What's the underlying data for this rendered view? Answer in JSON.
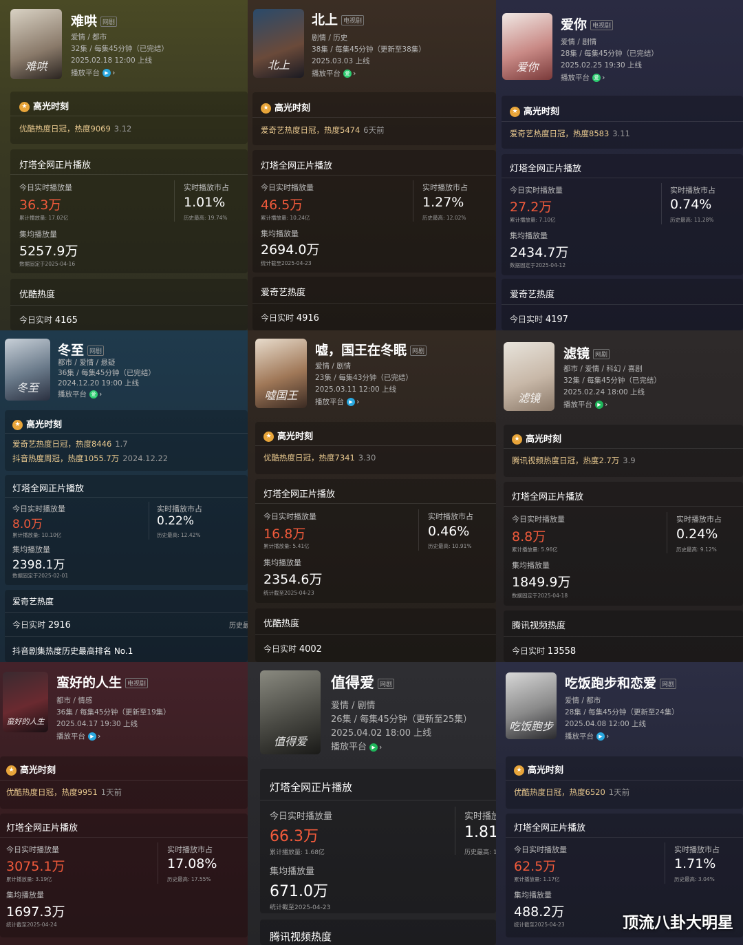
{
  "common": {
    "highlight_label": "高光时刻",
    "dengta_label": "灯塔全网正片播放",
    "today_label": "今日实时播放量",
    "share_label": "实时播放市占",
    "avg_label": "集均播放量",
    "today_live_label": "今日实时",
    "platform_label": "播放平台"
  },
  "watermark": "顶流八卦大明星",
  "cards": [
    {
      "title": "难哄",
      "tag": "网剧",
      "genre": "爱情 / 都市",
      "episodes": "32集 / 每集45分钟（已完结）",
      "release": "2025.02.18 12:00 上线",
      "poster_text": "难哄",
      "bg": "#3d3d21",
      "highlights": [
        {
          "text": "优酷热度日冠，热度9069",
          "date": "3.12"
        }
      ],
      "today": "36.3万",
      "total": "累计播放量: 17.02亿",
      "share": "1.01%",
      "share_peak": "历史最高: 19.74%",
      "avg": "5257.9万",
      "avg_note": "数据固定于2025-04-16",
      "heat_title": "优酷热度",
      "heat_value": "4165"
    },
    {
      "title": "北上",
      "tag": "电视剧",
      "genre": "剧情 / 历史",
      "episodes": "38集 / 每集45分钟（更新至38集）",
      "release": "2025.03.03 上线",
      "poster_text": "北上",
      "bg": "#2f261f",
      "highlights": [
        {
          "text": "爱奇艺热度日冠，热度5474",
          "date": "6天前"
        }
      ],
      "today": "46.5万",
      "total": "累计播放量: 10.24亿",
      "share": "1.27%",
      "share_peak": "历史最高: 12.02%",
      "avg": "2694.0万",
      "avg_note": "统计截至2025-04-23",
      "heat_title": "爱奇艺热度",
      "heat_value": "4916"
    },
    {
      "title": "爱你",
      "tag": "电视剧",
      "genre": "爱情 / 剧情",
      "episodes": "28集 / 每集45分钟（已完结）",
      "release": "2025.02.25 19:30 上线",
      "poster_text": "爱你",
      "bg": "#25263a",
      "highlights": [
        {
          "text": "爱奇艺热度日冠，热度8583",
          "date": "3.11"
        }
      ],
      "today": "27.2万",
      "total": "累计播放量: 7.10亿",
      "share": "0.74%",
      "share_peak": "历史最高: 11.28%",
      "avg": "2434.7万",
      "avg_note": "数据固定于2025-04-12",
      "heat_title": "爱奇艺热度",
      "heat_value": "4197"
    },
    {
      "title": "冬至",
      "tag": "网剧",
      "genre": "都市 / 爱情 / 悬疑",
      "episodes": "36集 / 每集45分钟（已完结）",
      "release": "2024.12.20 19:00 上线",
      "poster_text": "冬至",
      "bg": "#1d3242",
      "highlights": [
        {
          "text": "爱奇艺热度日冠，热度8446",
          "date": "1.7"
        },
        {
          "text": "抖音热度周冠，热度1055.7万",
          "date": "2024.12.22"
        }
      ],
      "today": "8.0万",
      "total": "累计播放量: 10.10亿",
      "share": "0.22%",
      "share_peak": "历史最高: 12.42%",
      "avg": "2398.1万",
      "avg_note": "数据固定于2025-02-01",
      "heat_title": "爱奇艺热度",
      "heat_value": "2916",
      "heat_extra": "历史最",
      "extra_line": "抖音剧集热度历史最高排名 No.1"
    },
    {
      "title": "嘘，国王在冬眠",
      "tag": "网剧",
      "genre": "爱情 / 剧情",
      "episodes": "23集 / 每集43分钟（已完结）",
      "release": "2025.03.11 12:00 上线",
      "poster_text": "嘘国王",
      "bg": "#2c2520",
      "highlights": [
        {
          "text": "优酷热度日冠，热度7341",
          "date": "3.30"
        }
      ],
      "today": "16.8万",
      "total": "累计播放量: 5.41亿",
      "share": "0.46%",
      "share_peak": "历史最高: 10.91%",
      "avg": "2354.6万",
      "avg_note": "统计截至2025-04-23",
      "heat_title": "优酷热度",
      "heat_value": "4002"
    },
    {
      "title": "滤镜",
      "tag": "网剧",
      "genre": "都市 / 爱情 / 科幻 / 喜剧",
      "episodes": "32集 / 每集45分钟（已完结）",
      "release": "2025.02.24 18:00 上线",
      "poster_text": "滤镜",
      "bg": "#2a2626",
      "highlights": [
        {
          "text": "腾讯视频热度日冠，热度2.7万",
          "date": "3.9"
        }
      ],
      "today": "8.8万",
      "total": "累计播放量: 5.96亿",
      "share": "0.24%",
      "share_peak": "历史最高: 9.12%",
      "avg": "1849.9万",
      "avg_note": "数据固定于2025-04-18",
      "heat_title": "腾讯视频热度",
      "heat_value": "13558"
    },
    {
      "title": "蛮好的人生",
      "tag": "电视剧",
      "genre": "都市 / 情感",
      "episodes": "36集 / 每集45分钟（更新至19集）",
      "release": "2025.04.17 19:30 上线",
      "poster_text": "蛮好的人生",
      "bg": "#3a1e22",
      "highlights": [
        {
          "text": "优酷热度日冠，热度9951",
          "date": "1天前"
        }
      ],
      "today": "3075.1万",
      "total": "累计播放量: 3.19亿",
      "share": "17.08%",
      "share_peak": "历史最高: 17.55%",
      "avg": "1697.3万",
      "avg_note": "统计截至2025-04-24"
    },
    {
      "title": "值得爱",
      "tag": "网剧",
      "genre": "爱情 / 剧情",
      "episodes": "26集 / 每集45分钟（更新至25集）",
      "release": "2025.04.02 18:00 上线",
      "poster_text": "值得爱",
      "bg": "#2a2a2e",
      "today": "66.3万",
      "total": "累计播放量: 1.68亿",
      "share": "1.81",
      "share_label_cut": "实时播放",
      "share_peak": "历史最高: 1",
      "avg": "671.0万",
      "avg_note": "统计截至2025-04-23",
      "heat_title": "腾讯视频热度"
    },
    {
      "title": "吃饭跑步和恋爱",
      "tag": "网剧",
      "genre": "爱情 / 都市",
      "episodes": "28集 / 每集45分钟（更新至24集）",
      "release": "2025.04.08 12:00 上线",
      "poster_text": "吃饭跑步",
      "bg": "#26283a",
      "highlights": [
        {
          "text": "优酷热度日冠，热度6520",
          "date": "1天前"
        }
      ],
      "today": "62.5万",
      "total": "累计播放量: 1.17亿",
      "share": "1.71%",
      "share_peak": "历史最高: 3.04%",
      "avg": "488.2万",
      "avg_note": "统计截至2025-04-23"
    }
  ]
}
